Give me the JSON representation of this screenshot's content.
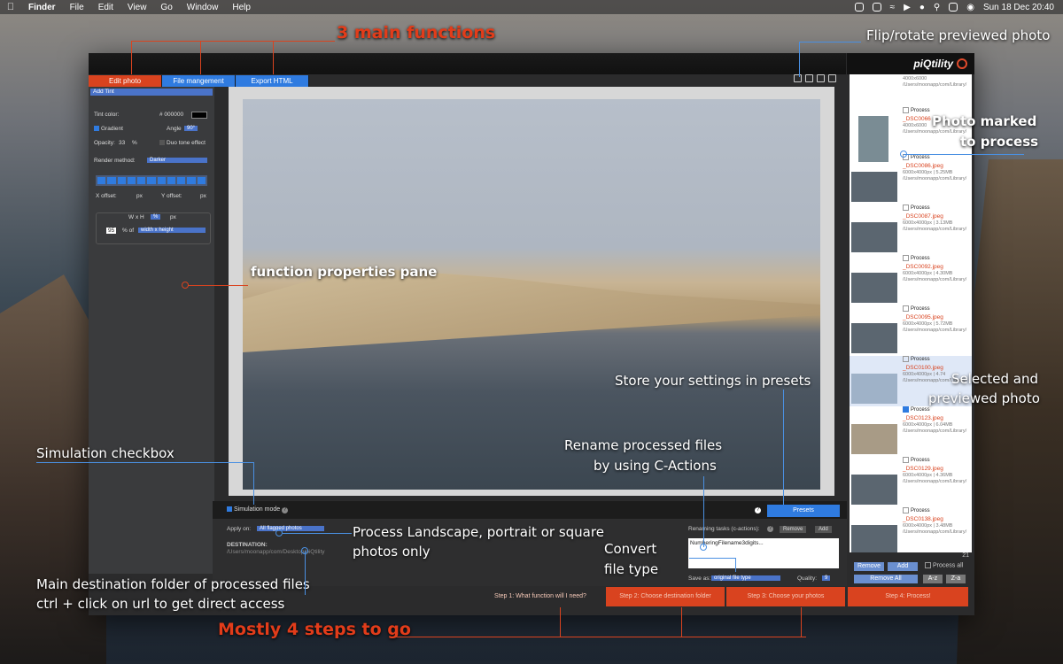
{
  "menubar": {
    "app": "Finder",
    "menus": [
      "File",
      "Edit",
      "View",
      "Go",
      "Window",
      "Help"
    ],
    "clock": "Sun 18 Dec  20:40"
  },
  "app": {
    "brand": "piQtility",
    "tabs": [
      "Edit photo",
      "File mangement",
      "Export HTML"
    ]
  },
  "leftpane": {
    "function": "Add Tint",
    "tint_color_label": "Tint color:",
    "tint_hex": "# 000000",
    "gradient_label": "Gradient",
    "angle_label": "Angle",
    "angle_value": "90°",
    "opacity_label": "Opacity:",
    "opacity_value": "33",
    "percent": "%",
    "duo_tone_label": "Duo tone effect",
    "render_label": "Render method:",
    "render_value": "Darker",
    "x_offset_label": "X offset:",
    "y_offset_label": "Y offset:",
    "px": "px",
    "wxh_label": "W x H",
    "size_value": "95",
    "size_of": "% of",
    "size_basis": "width x height"
  },
  "bottom": {
    "simulation_label": "Simulation mode",
    "presets_label": "Presets",
    "help": "?",
    "apply_on_label": "Apply on:",
    "apply_on_value": "All flagged photos",
    "destination_label": "DESTINATION:",
    "destination_path": "/Users/moonapp/com/Desktop/piQtility",
    "renaming_label": "Renaming tasks (c-actions):",
    "remove_label": "Remove",
    "add_label": "Add",
    "renaming_text": "NumberingFilename3digits...",
    "save_as_label": "Save as:",
    "save_as_value": "original file type",
    "quality_label": "Quality:",
    "quality_value": "9"
  },
  "steps": [
    "Step 1: What function will I need?",
    "Step 2: Choose destination folder",
    "Step 3: Choose your photos",
    "Step 4: Process!"
  ],
  "rightpane": {
    "process_label": "Process",
    "items": [
      {
        "name": "",
        "meta1": "4000x6000",
        "meta2": "/Users/moonapp/com/Library/"
      },
      {
        "name": "_DSC0066",
        "meta1": "4000x6000",
        "meta2": "/Users/moonapp/com/Library/"
      },
      {
        "name": "_DSC0086.jpeg",
        "meta1": "6000x4000px | 5.25MB",
        "meta2": "/Users/moonapp/com/Library/"
      },
      {
        "name": "_DSC0087.jpeg",
        "meta1": "6000x4000px | 3.13MB",
        "meta2": "/Users/moonapp/com/Library/"
      },
      {
        "name": "_DSC0092.jpeg",
        "meta1": "6000x4000px | 4.30MB",
        "meta2": "/Users/moonapp/com/Library/"
      },
      {
        "name": "_DSC0095.jpeg",
        "meta1": "6000x4000px | 5.72MB",
        "meta2": "/Users/moonapp/com/Library/"
      },
      {
        "name": "_DSC0100.jpeg",
        "meta1": "6000x4000px | 4.74",
        "meta2": "/Users/moonapp/com/Library/"
      },
      {
        "name": "_DSC0123.jpeg",
        "meta1": "6000x4000px | 6.04MB",
        "meta2": "/Users/moonapp/com/Library/"
      },
      {
        "name": "_DSC0129.jpeg",
        "meta1": "6000x4000px | 4.36MB",
        "meta2": "/Users/moonapp/com/Library/"
      },
      {
        "name": "_DSC0138.jpeg",
        "meta1": "6000x4000px | 3.48MB",
        "meta2": "/Users/moonapp/com/Library/"
      }
    ],
    "count": "21",
    "remove_label": "Remove",
    "add_label": "Add",
    "process_all_label": "Process all",
    "remove_all_label": "Remove All",
    "sort_az": "A-z",
    "sort_za": "Z-a"
  },
  "annotations": {
    "three_functions": "3 main functions",
    "flip_rotate": "Flip/rotate previewed photo",
    "photo_marked_1": "Photo marked",
    "photo_marked_2": "to process",
    "function_pane": "function properties pane",
    "store_presets": "Store your settings in presets",
    "selected_1": "Selected and",
    "selected_2": "previewed photo",
    "rename_1": "Rename processed files",
    "rename_2": "by using C-Actions",
    "simulation": "Simulation checkbox",
    "process_orient_1": "Process Landscape, portrait or square",
    "process_orient_2": "photos only",
    "convert_1": "Convert",
    "convert_2": "file type",
    "destination_1": "Main destination folder of processed files",
    "destination_2": "ctrl + click on url to get direct access",
    "four_steps": "Mostly 4 steps to go"
  },
  "colors": {
    "accent": "#2f7be0",
    "brand_red": "#d9431f",
    "annotation_line": "#4a90e2"
  }
}
